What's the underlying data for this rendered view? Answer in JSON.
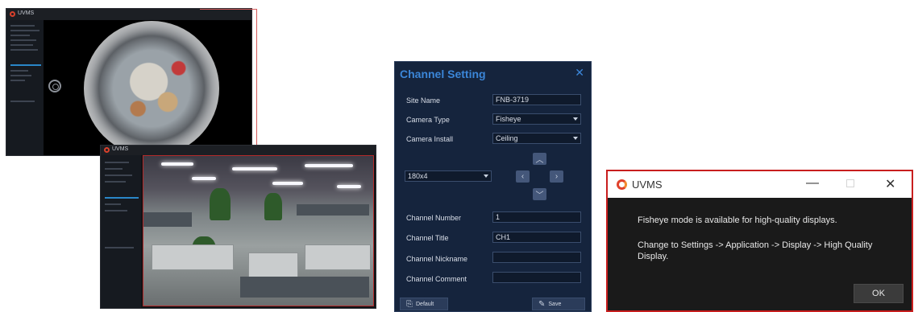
{
  "fisheye_window": {
    "logo_text": "UVMS",
    "icons": [
      "ptz-icon"
    ]
  },
  "office_window": {
    "logo_text": "UVMS"
  },
  "channel_setting": {
    "title": "Channel Setting",
    "close_glyph": "✕",
    "fields": [
      {
        "label": "Site Name",
        "value": "FNB-3719"
      },
      {
        "label": "Camera Type",
        "value": "Fisheye"
      },
      {
        "label": "Camera Install",
        "value": "Ceiling"
      }
    ],
    "view_select": "180x4",
    "ptz_glyphs": {
      "up": "︿",
      "left": "‹",
      "right": "›",
      "down": "﹀"
    },
    "channel_fields": [
      {
        "label": "Channel Number",
        "value": "1"
      },
      {
        "label": "Channel Title",
        "value": "CH1"
      },
      {
        "label": "Channel Nickname",
        "value": ""
      },
      {
        "label": "Channel Comment",
        "value": ""
      }
    ],
    "default_button": "Default",
    "save_button": "Save"
  },
  "message_box": {
    "app_title": "UVMS",
    "minimize_glyph": "—",
    "close_glyph": "✕",
    "line1": "Fisheye mode is available for high-quality displays.",
    "line2": "Change to Settings -> Application -> Display -> High Quality Display.",
    "ok_button": "OK",
    "border_color": "#c81e1e"
  }
}
